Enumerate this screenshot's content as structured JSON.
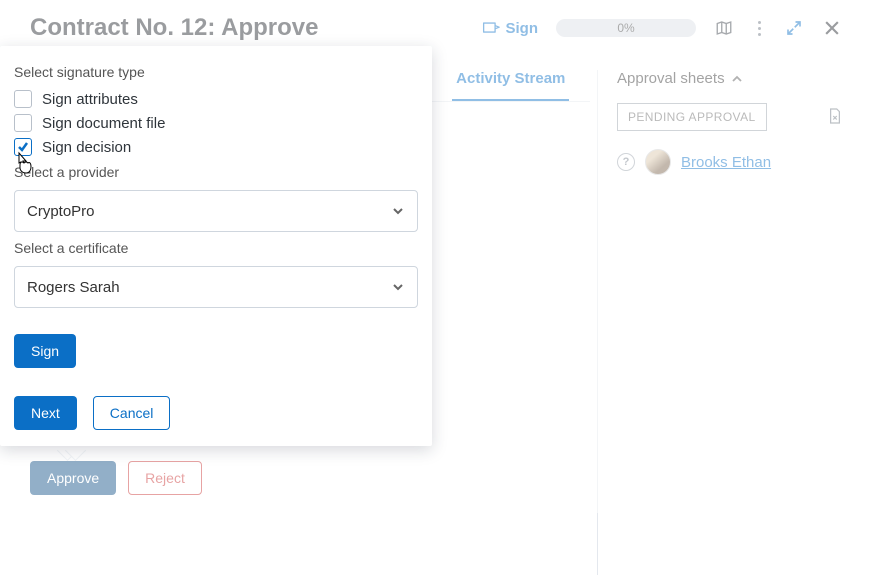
{
  "header": {
    "title": "Contract No. 12: Approve",
    "sign_label": "Sign",
    "progress_text": "0%"
  },
  "tabs": {
    "activity": "Activity Stream"
  },
  "approval_panel": {
    "heading": "Approval sheets",
    "status": "PENDING APPROVAL",
    "user_name": "Brooks Ethan"
  },
  "footer": {
    "approve": "Approve",
    "reject": "Reject"
  },
  "modal": {
    "section_signature_type": "Select signature type",
    "opt_attributes": "Sign attributes",
    "opt_document_file": "Sign document file",
    "opt_decision": "Sign decision",
    "section_provider": "Select a provider",
    "provider_value": "CryptoPro",
    "section_certificate": "Select a certificate",
    "certificate_value": "Rogers Sarah",
    "sign_button": "Sign",
    "next_button": "Next",
    "cancel_button": "Cancel"
  }
}
